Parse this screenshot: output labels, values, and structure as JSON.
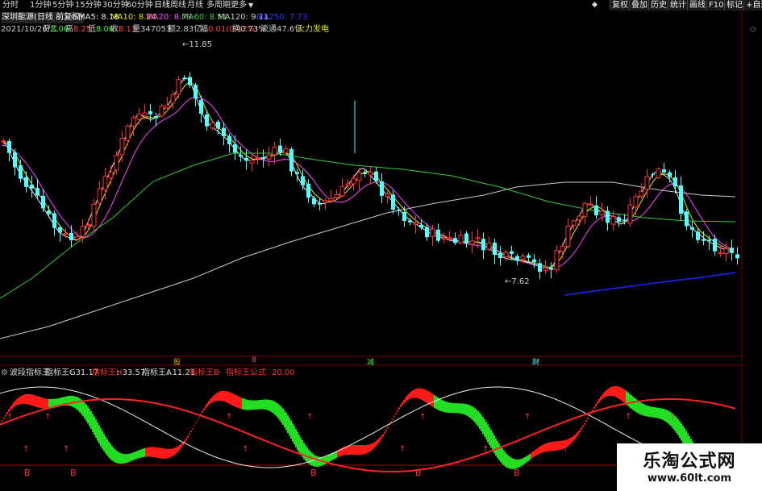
{
  "toolbar": {
    "periods": [
      "分时",
      "1分钟",
      "5分钟",
      "15分钟",
      "30分钟",
      "60分钟",
      "日线",
      "周线",
      "月线",
      "多周期",
      "更多"
    ],
    "active_period": "日线",
    "right_buttons": [
      "复权",
      "叠加",
      "历史",
      "统计",
      "画线",
      "F10",
      "标记",
      "+自选"
    ]
  },
  "ma_line": {
    "title": "深圳能源(日线 前复权)",
    "ma5": "MA5: 8.18",
    "ma10": "MA10: 8.24",
    "ma20": "MA20: 8.79",
    "ma60": "MA60: 8.51",
    "ma120": "MA120: 9.11",
    "ma250": "MA250: 7.73"
  },
  "info_line": {
    "date": "2021/10/26/二",
    "open_label": "开",
    "open": "8.06",
    "high_label": "高",
    "high": "8.25",
    "low_label": "低",
    "low": "8.06",
    "close_label": "收",
    "close": "8.13",
    "volume_label": "量",
    "volume": "347053",
    "amount_label": "额",
    "amount": "2.83亿",
    "change_label": "幅",
    "change": "0.01(0.12%)",
    "turnover_label": "换",
    "turnover": "0.73%",
    "float_label": "流通",
    "float_cap": "47.6亿",
    "sector": "火力发电"
  },
  "price_annotations": {
    "high": "11.85",
    "low": "7.62"
  },
  "event_markers": [
    "股",
    "8",
    "减",
    "财"
  ],
  "indicator": {
    "name": "波段指标王",
    "g_label": "指标王G",
    "g_value": "31.17",
    "h_label": "指标王H",
    "h_value": "33.57",
    "a_label": "指标王A",
    "a_value": "11.21",
    "b_label": "指标王B",
    "formula_label": "指标王公式",
    "formula_value": "20.00",
    "signal_letter": "B"
  },
  "colors": {
    "up": "#ff3232",
    "down": "#54ffff",
    "ma5": "#e8e8e8",
    "ma10": "#e6e600",
    "ma20": "#ff44ff",
    "ma60": "#33cc33",
    "ma120": "#cccccc",
    "ma250": "#2222ff",
    "wave_red": "#ff1a1a",
    "wave_green": "#22dd22"
  },
  "watermark": {
    "title": "乐淘公式网",
    "url": "www.60lt.com"
  }
}
